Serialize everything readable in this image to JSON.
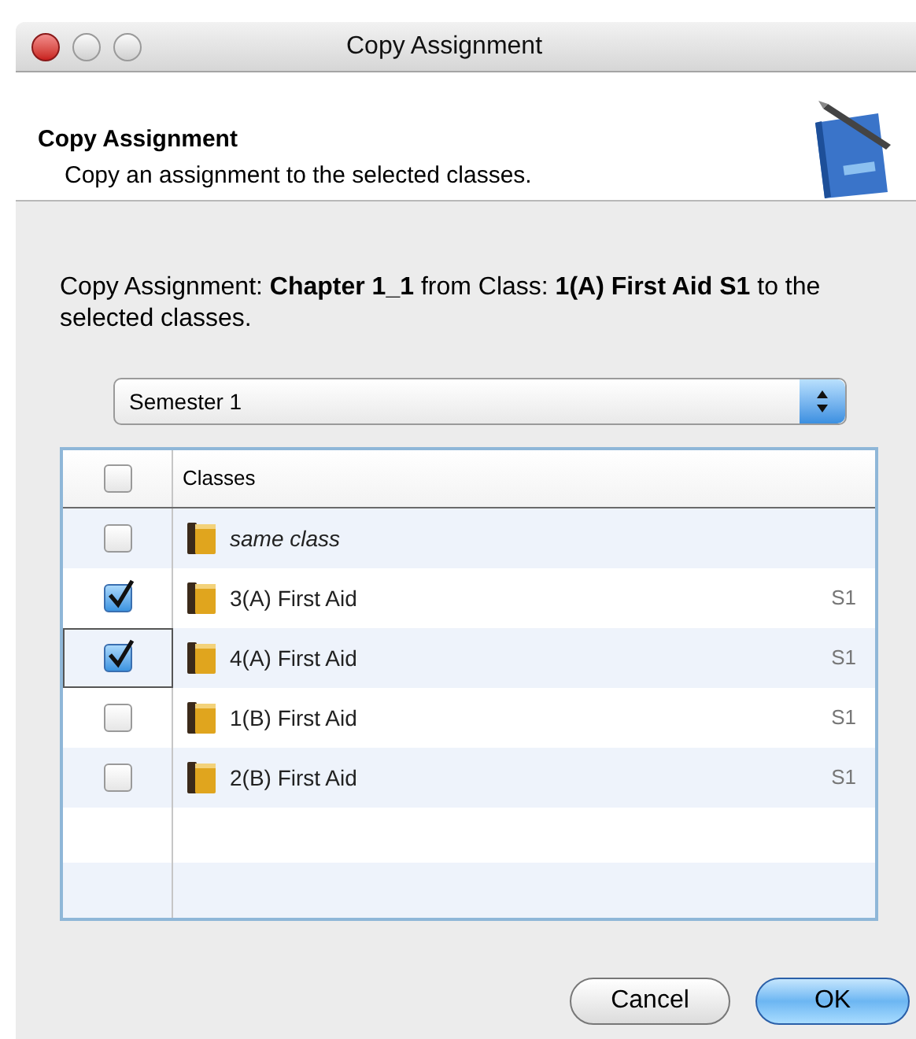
{
  "window": {
    "title": "Copy Assignment"
  },
  "header": {
    "title": "Copy Assignment",
    "subtitle": "Copy an assignment to the selected classes."
  },
  "description": "Copy Assignment: **Chapter 1_1** from Class: **1(A) First Aid S1** to the selected classes.",
  "semester_select": {
    "value": "Semester 1"
  },
  "table": {
    "select_all": {
      "checked": false
    },
    "columns": [
      "Classes"
    ],
    "rows": [
      {
        "kind": "special",
        "name": "same class",
        "checked": false,
        "focused": false
      },
      {
        "kind": "class",
        "name": "3(A) First Aid",
        "term": "S1",
        "checked": true,
        "focused": false
      },
      {
        "kind": "class",
        "name": "4(A) First Aid",
        "term": "S1",
        "checked": true,
        "focused": true
      },
      {
        "kind": "class",
        "name": "1(B) First Aid",
        "term": "S1",
        "checked": false,
        "focused": false
      },
      {
        "kind": "class",
        "name": "2(B) First Aid",
        "term": "S1",
        "checked": false,
        "focused": false
      }
    ]
  },
  "buttons": [
    {
      "label": "Cancel",
      "default": false
    },
    {
      "label": "OK",
      "default": true
    }
  ]
}
